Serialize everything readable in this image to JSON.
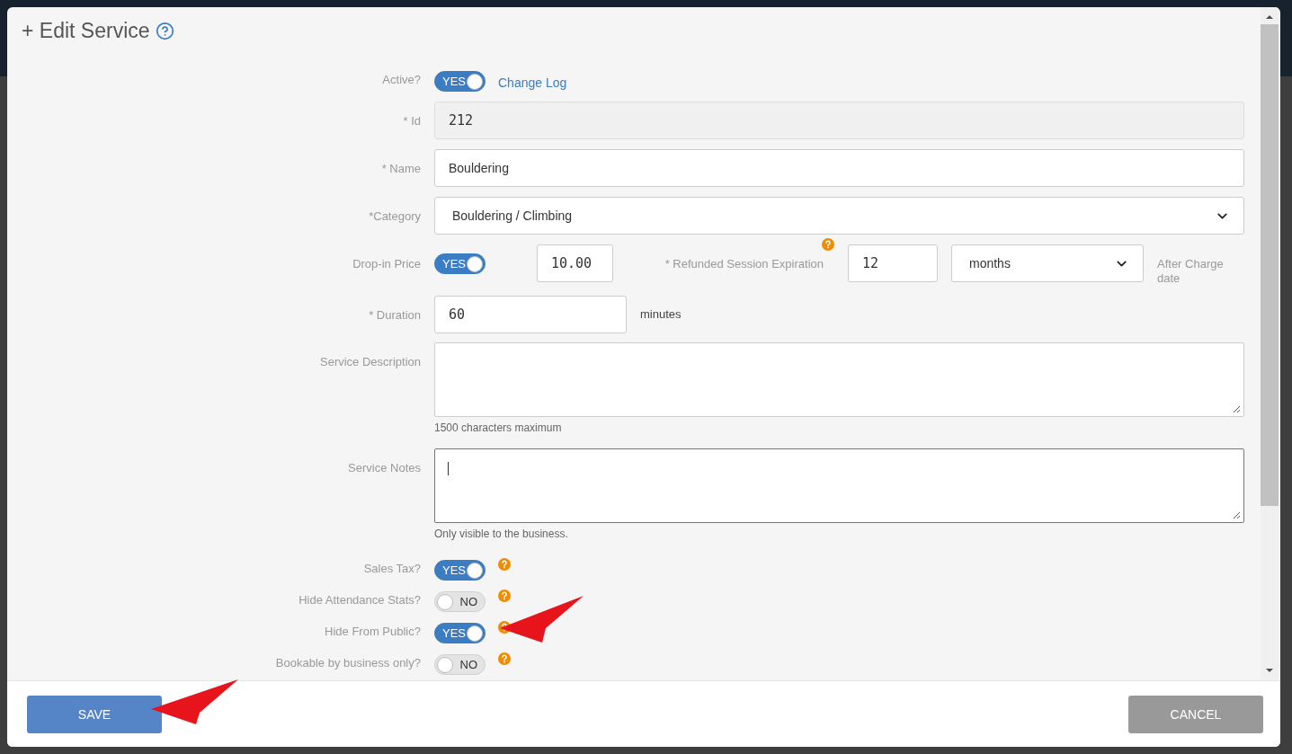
{
  "dialog": {
    "title": "+ Edit Service"
  },
  "rows": [
    {
      "kind": "toggle",
      "label": "Active?",
      "toggle": {
        "on": true,
        "text": "YES"
      },
      "link": "Change Log"
    },
    {
      "kind": "readonly",
      "label": "* Id",
      "value": "212"
    },
    {
      "kind": "text",
      "label": "* Name",
      "value": "Bouldering"
    },
    {
      "kind": "select",
      "label": "*Category",
      "value": "Bouldering / Climbing"
    },
    {
      "kind": "price",
      "label": "Drop-in Price",
      "toggle": {
        "on": true,
        "text": "YES"
      },
      "value": "10.00",
      "expiration_label": "* Refunded Session Expiration",
      "expiration_value": "12",
      "unit": "months",
      "suffix": "After Charge date"
    },
    {
      "kind": "duration",
      "label": "* Duration",
      "value": "60",
      "suffix": "minutes"
    },
    {
      "kind": "textarea",
      "label": "Service Description",
      "value": "",
      "hint": "1500 characters maximum",
      "focused": false
    },
    {
      "kind": "textarea",
      "label": "Service Notes",
      "value": "",
      "hint": "Only visible to the business.",
      "focused": true
    },
    {
      "kind": "toggle",
      "label": "Sales Tax?",
      "toggle": {
        "on": true,
        "text": "YES"
      },
      "help": true
    },
    {
      "kind": "toggle",
      "label": "Hide Attendance Stats?",
      "toggle": {
        "on": false,
        "text": "NO"
      },
      "help": true
    },
    {
      "kind": "toggle",
      "label": "Hide From Public?",
      "toggle": {
        "on": true,
        "text": "YES"
      },
      "help": true
    },
    {
      "kind": "toggle",
      "label": "Bookable by business only?",
      "toggle": {
        "on": false,
        "text": "NO"
      },
      "help": true
    }
  ],
  "buttons": [
    {
      "kind": "primary",
      "label": "SAVE"
    },
    {
      "kind": "secondary",
      "label": "CANCEL"
    }
  ]
}
